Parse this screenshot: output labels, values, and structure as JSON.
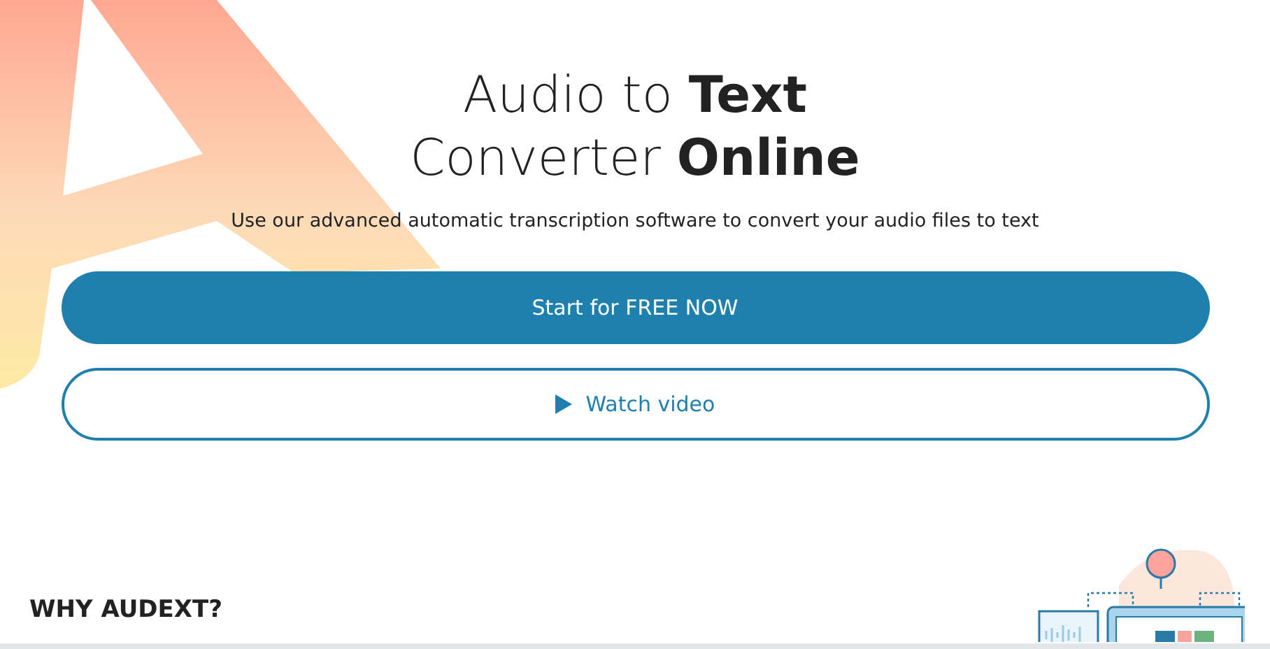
{
  "hero": {
    "title_lines": [
      "Audio to **Text**",
      "Converter **Online**"
    ],
    "subtitle": "Use our advanced automatic transcription software to convert your audio files to text",
    "primary_button": "Start for FREE NOW",
    "secondary_button": "Watch video"
  },
  "section": {
    "heading": "WHY AUDEXT?"
  }
}
